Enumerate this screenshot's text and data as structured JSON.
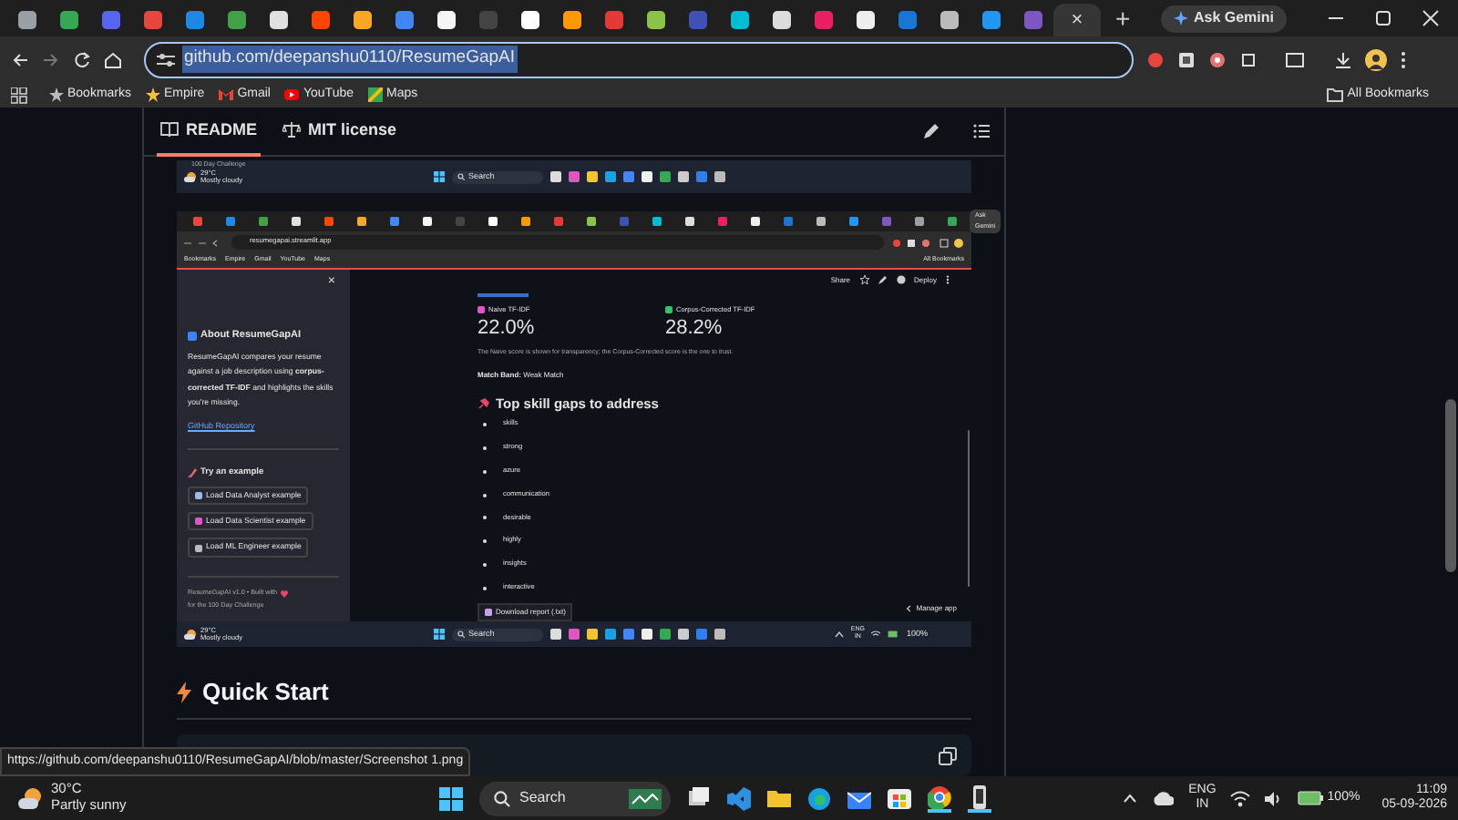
{
  "browser": {
    "tabs": [
      {
        "selected": false
      },
      {
        "selected": false
      },
      {
        "selected": false
      },
      {
        "selected": false
      },
      {
        "selected": false
      },
      {
        "selected": false
      },
      {
        "selected": false
      },
      {
        "selected": false
      },
      {
        "selected": false
      },
      {
        "selected": false
      },
      {
        "selected": false
      },
      {
        "selected": false
      },
      {
        "selected": false
      },
      {
        "selected": false
      },
      {
        "selected": false
      },
      {
        "selected": false
      },
      {
        "selected": false
      },
      {
        "selected": false
      },
      {
        "selected": false
      },
      {
        "selected": false
      },
      {
        "selected": false
      },
      {
        "selected": false
      },
      {
        "selected": false
      },
      {
        "selected": false
      },
      {
        "selected": false
      },
      {
        "selected": true
      }
    ],
    "tab_close": "×",
    "new_tab": "+",
    "ask_gemini": "Ask Gemini",
    "address": {
      "text": "github.com/deepanshu0110/ResumeGapAI",
      "selected": true
    },
    "bookmarks": [
      "Bookmarks",
      "Empire",
      "Gmail",
      "YouTube",
      "Maps"
    ],
    "all_bookmarks": "All Bookmarks"
  },
  "readme": {
    "tabs": [
      {
        "label": "README",
        "selected": true
      },
      {
        "label": "MIT license",
        "selected": false
      }
    ],
    "screenshot": {
      "top_taskbar": {
        "caption": "100 Day Challenge",
        "temperature": "29°C",
        "weather": "Mostly cloudy",
        "search": "Search"
      },
      "browser": {
        "address": "resumegapai.streamlit.app",
        "ask_gemini": "Ask Gemini",
        "bookmarks": [
          "Bookmarks",
          "Empire",
          "Gmail",
          "YouTube",
          "Maps"
        ],
        "all_bookmarks": "All Bookmarks"
      },
      "toolbar": {
        "share": "Share",
        "deploy": "Deploy"
      },
      "sidebar": {
        "close": "×",
        "about_title": "About ResumeGapAI",
        "about_text": "ResumeGapAI compares your resume against a job description using **corpus-corrected TF-IDF** and highlights the skills you're missing.",
        "link": "GitHub Repository",
        "examples_title": "Try an example",
        "examples": [
          "Load Data Analyst example",
          "Load Data Scientist example",
          "Load ML Engineer example"
        ],
        "footer": [
          "ResumeGapAI v1.0 • Built with",
          "for the 100 Day Challenge"
        ]
      },
      "metrics": [
        {
          "label": "Naive TF-IDF",
          "value": "22.0%",
          "color": "#d957c9"
        },
        {
          "label": "Corpus-Corrected TF-IDF",
          "value": "28.2%",
          "color": "#3dbf6a"
        }
      ],
      "caption": "The Naive score is shown for transparency; the Corpus-Corrected score is the one to trust.",
      "match_band": "**Match Band:** Weak Match",
      "gaps_title": "Top skill gaps to address",
      "gaps": [
        "skills",
        "strong",
        "azure",
        "communication",
        "desirable",
        "highly",
        "insights",
        "interactive"
      ],
      "download": "Download report (.txt)",
      "manage_app": "Manage app",
      "bottom_taskbar": {
        "temperature": "29°C",
        "weather": "Mostly cloudy",
        "search": "Search",
        "language": [
          "ENG",
          "IN"
        ],
        "battery": "100%"
      }
    },
    "quick_start": "Quick Start"
  },
  "status_url": "https://github.com/deepanshu0110/ResumeGapAI/blob/master/Screenshot 1.png",
  "taskbar": {
    "temperature": "30°C",
    "weather": "Partly sunny",
    "search": "Search",
    "language": [
      "ENG",
      "IN"
    ],
    "battery": "100%",
    "time": "11:09",
    "date": "05-09-2026"
  }
}
